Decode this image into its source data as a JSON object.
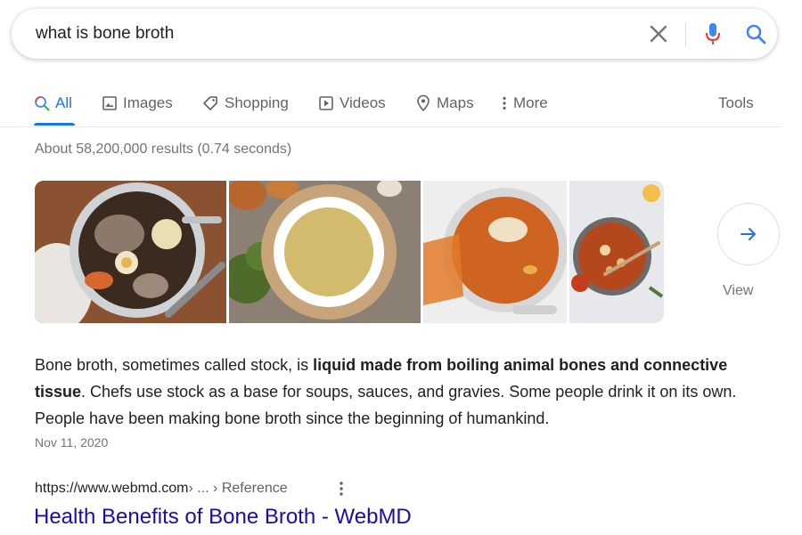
{
  "search": {
    "query": "what is bone broth"
  },
  "tabs": [
    {
      "label": "All",
      "icon": "search-icon",
      "active": true
    },
    {
      "label": "Images",
      "icon": "image-icon"
    },
    {
      "label": "Shopping",
      "icon": "tag-icon"
    },
    {
      "label": "Videos",
      "icon": "play-icon"
    },
    {
      "label": "Maps",
      "icon": "map-pin-icon"
    },
    {
      "label": "More",
      "icon": "more-vert-icon"
    }
  ],
  "tools_label": "Tools",
  "result_stats": "About 58,200,000 results (0.74 seconds)",
  "images": {
    "view_all_label": "View"
  },
  "snippet": {
    "part1": "Bone broth, sometimes called stock, is ",
    "bold": "liquid made from boiling animal bones and connective tissue",
    "part2": ". Chefs use stock as a base for soups, sauces, and gravies. Some people drink it on its own. People have been making bone broth since the beginning of humankind.",
    "date": "Nov 11, 2020"
  },
  "result": {
    "url": "https://www.webmd.com",
    "breadcrumb": " › ... › Reference",
    "title": "Health Benefits of Bone Broth - WebMD"
  },
  "colors": {
    "accent": "#1a73e8",
    "link": "#1a0dab",
    "muted": "#70757a"
  }
}
